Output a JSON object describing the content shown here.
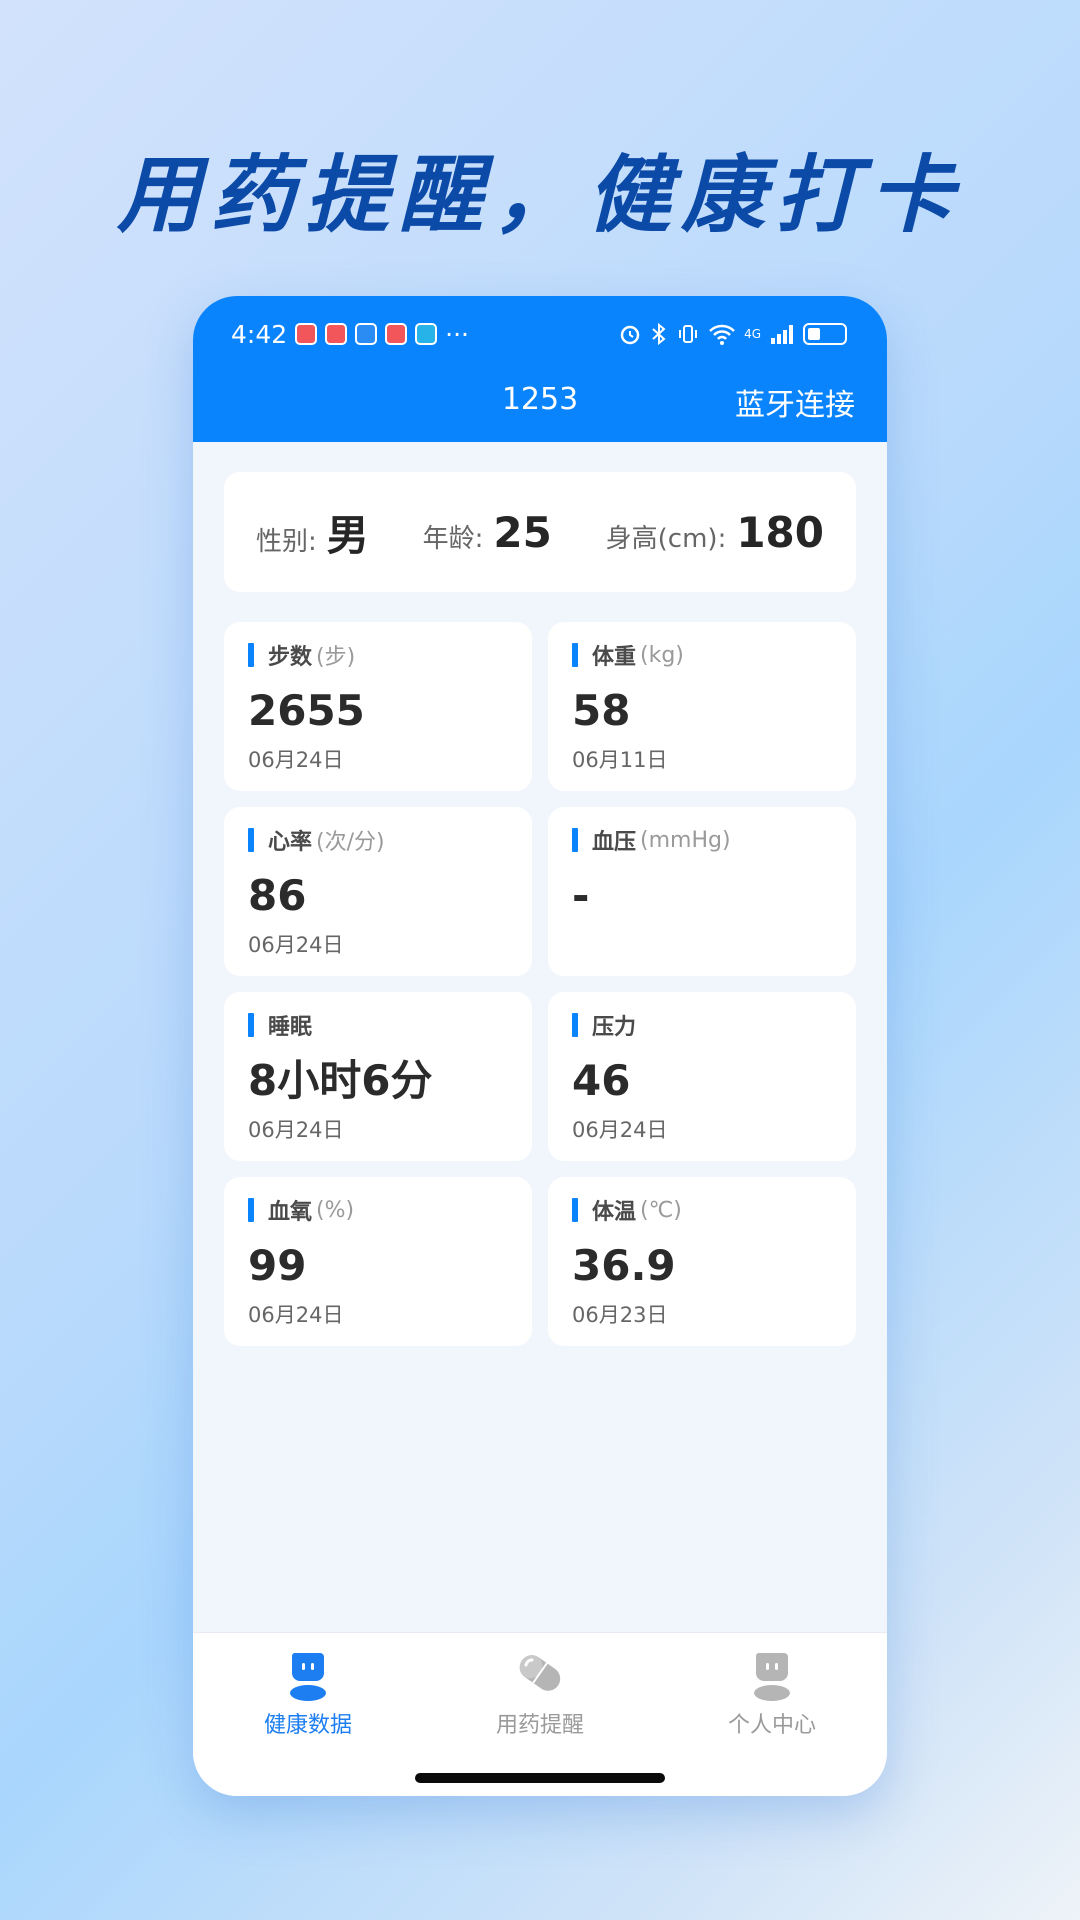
{
  "promo": {
    "title": "用药提醒，健康打卡"
  },
  "status_bar": {
    "time": "4:42",
    "more": "···",
    "network": "4G"
  },
  "nav": {
    "title": "1253",
    "action": "蓝牙连接"
  },
  "profile": {
    "gender_label": "性别:",
    "gender_value": "男",
    "age_label": "年龄:",
    "age_value": "25",
    "height_label": "身高(cm):",
    "height_value": "180"
  },
  "metrics": [
    {
      "name": "步数",
      "unit": "(步)",
      "value": "2655",
      "date": "06月24日"
    },
    {
      "name": "体重",
      "unit": "(kg)",
      "value": "58",
      "date": "06月11日"
    },
    {
      "name": "心率",
      "unit": "(次/分)",
      "value": "86",
      "date": "06月24日"
    },
    {
      "name": "血压",
      "unit": "(mmHg)",
      "value": "-",
      "date": ""
    },
    {
      "name": "睡眠",
      "unit": "",
      "value": "8小时6分",
      "date": "06月24日"
    },
    {
      "name": "压力",
      "unit": "",
      "value": "46",
      "date": "06月24日"
    },
    {
      "name": "血氧",
      "unit": "(%)",
      "value": "99",
      "date": "06月24日"
    },
    {
      "name": "体温",
      "unit": "(℃)",
      "value": "36.9",
      "date": "06月23日"
    }
  ],
  "tabs": [
    {
      "label": "健康数据",
      "icon": "health-data-icon",
      "active": true
    },
    {
      "label": "用药提醒",
      "icon": "pill-icon",
      "active": false
    },
    {
      "label": "个人中心",
      "icon": "profile-icon",
      "active": false
    }
  ],
  "colors": {
    "accent": "#0a84fc",
    "active_tab": "#1c7ef0",
    "inactive_tab": "#9a9a9a"
  }
}
